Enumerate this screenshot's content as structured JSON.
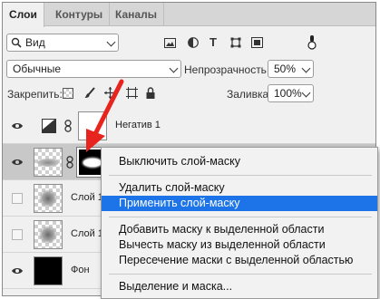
{
  "tabs": [
    "Слои",
    "Контуры",
    "Каналы"
  ],
  "filter": {
    "label": "Вид"
  },
  "blend": {
    "mode": "Обычные",
    "opacity_label": "Непрозрачность:",
    "opacity_value": "50%"
  },
  "lock": {
    "label": "Закрепить:",
    "fill_label": "Заливка:",
    "fill_value": "100%"
  },
  "layers": [
    {
      "name": "Негатив 1",
      "visible": true
    },
    {
      "name": "",
      "visible": true
    },
    {
      "name": "Слой 1",
      "visible": false
    },
    {
      "name": "Слой 1",
      "visible": false
    },
    {
      "name": "Фон",
      "visible": true
    }
  ],
  "menu": {
    "items": [
      "Выключить слой-маску",
      "Удалить слой-маску",
      "Применить слой-маску",
      "Добавить маску к выделенной области",
      "Вычесть маску из выделенной области",
      "Пересечение маски с выделенной областью",
      "Выделение и маска..."
    ],
    "highlighted": "Применить слой-маску"
  },
  "colors": {
    "highlight": "#1c74e8",
    "arrow": "#e8241f"
  }
}
